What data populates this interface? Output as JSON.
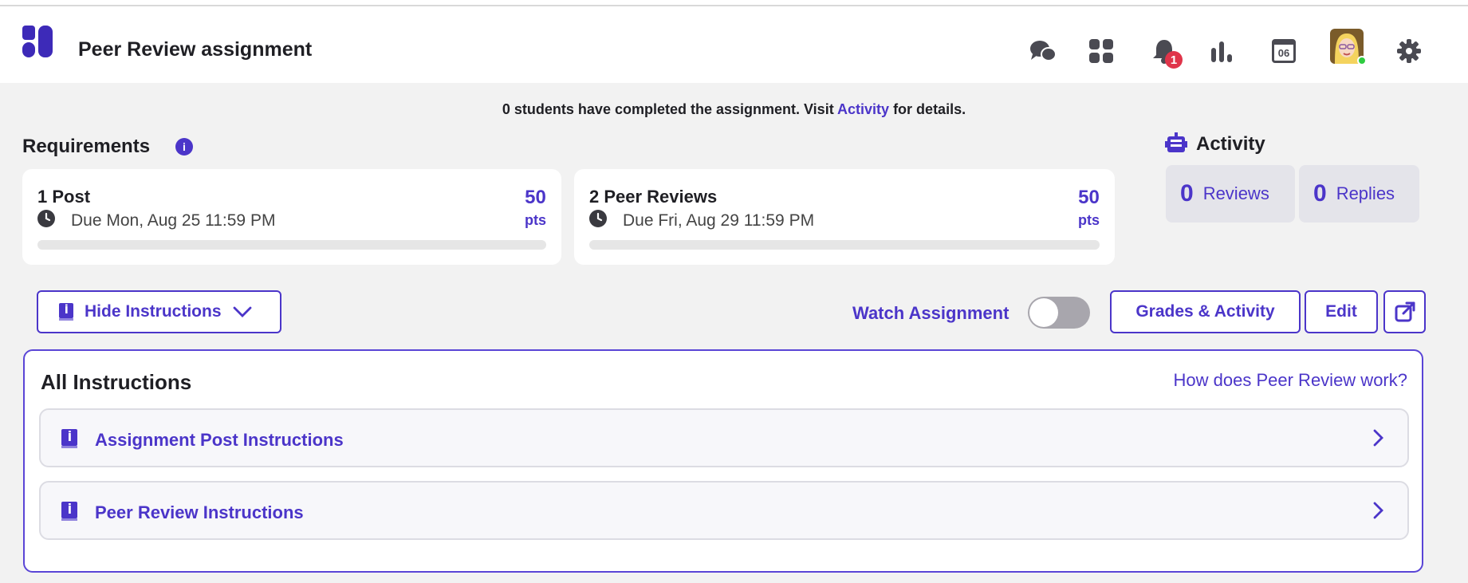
{
  "header": {
    "title": "Peer Review assignment",
    "notifications_count": "1",
    "calendar_day": "06",
    "icons": [
      "chat-icon",
      "apps-grid-icon",
      "bell-icon",
      "chart-icon",
      "calendar-icon",
      "avatar",
      "gear-icon"
    ]
  },
  "notice": {
    "prefix": "0 students have completed the assignment. Visit ",
    "link": "Activity",
    "suffix": " for details."
  },
  "requirements": {
    "title": "Requirements",
    "info": "i",
    "items": [
      {
        "title": "1 Post",
        "due": "Due Mon, Aug 25 11:59 PM",
        "points": "50",
        "unit": "pts",
        "progress": 0
      },
      {
        "title": "2 Peer Reviews",
        "due": "Due Fri, Aug 29 11:59 PM",
        "points": "50",
        "unit": "pts",
        "progress": 0
      }
    ]
  },
  "activity": {
    "title": "Activity",
    "reviews_count": "0",
    "reviews_label": "Reviews",
    "replies_count": "0",
    "replies_label": "Replies"
  },
  "toolbar": {
    "hide_instructions": "Hide Instructions",
    "watch_label": "Watch Assignment",
    "watch_on": false,
    "grades_activity": "Grades & Activity",
    "edit": "Edit"
  },
  "instructions": {
    "title": "All Instructions",
    "help_link": "How does Peer Review work?",
    "items": [
      {
        "label": "Assignment Post Instructions"
      },
      {
        "label": "Peer Review Instructions"
      }
    ]
  },
  "colors": {
    "accent": "#4b35c9",
    "background": "#f2f2f2",
    "badge": "#e0344a",
    "online": "#2ecc40"
  }
}
